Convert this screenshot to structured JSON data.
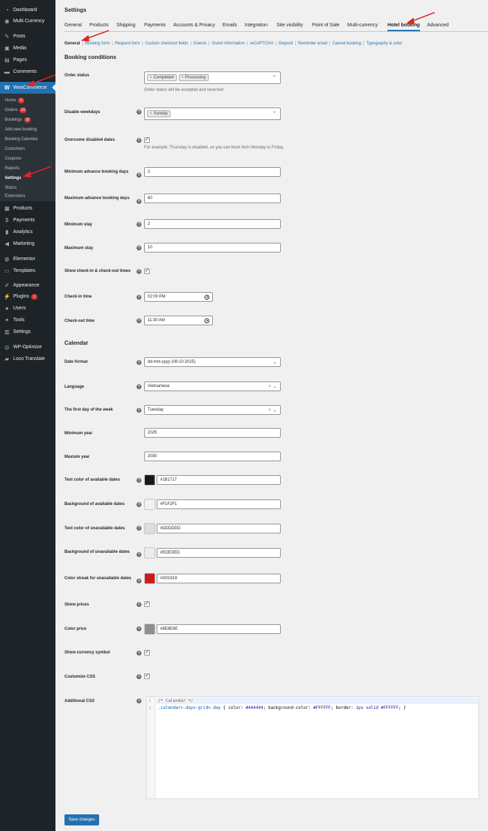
{
  "sidebar": {
    "items": [
      {
        "label": "Dashboard",
        "icon": "dashboard-icon",
        "glyph": "◔"
      },
      {
        "label": "Multi Currency",
        "icon": "currency-icon",
        "glyph": "◉"
      },
      {
        "label": "Posts",
        "icon": "pin-icon",
        "glyph": "✎"
      },
      {
        "label": "Media",
        "icon": "media-icon",
        "glyph": "▣"
      },
      {
        "label": "Pages",
        "icon": "pages-icon",
        "glyph": "▤"
      },
      {
        "label": "Comments",
        "icon": "comment-icon",
        "glyph": "▬"
      },
      {
        "label": "WooCommerce",
        "icon": "woocommerce-icon",
        "glyph": "W"
      },
      {
        "label": "Products",
        "icon": "products-icon",
        "glyph": "▦"
      },
      {
        "label": "Payments",
        "icon": "payments-icon",
        "glyph": "$"
      },
      {
        "label": "Analytics",
        "icon": "analytics-icon",
        "glyph": "▮"
      },
      {
        "label": "Marketing",
        "icon": "megaphone-icon",
        "glyph": "◀"
      },
      {
        "label": "Elementor",
        "icon": "elementor-icon",
        "glyph": "◍"
      },
      {
        "label": "Templates",
        "icon": "folder-icon",
        "glyph": "▭"
      },
      {
        "label": "Appearance",
        "icon": "brush-icon",
        "glyph": "✐"
      },
      {
        "label": "Plugins",
        "icon": "plugin-icon",
        "glyph": "⚡",
        "badge": "1"
      },
      {
        "label": "Users",
        "icon": "user-icon",
        "glyph": "●"
      },
      {
        "label": "Tools",
        "icon": "wrench-icon",
        "glyph": "✦"
      },
      {
        "label": "Settings",
        "icon": "settings-icon",
        "glyph": "▥"
      },
      {
        "label": "WP-Optimize",
        "icon": "optimize-icon",
        "glyph": "◎"
      },
      {
        "label": "Loco Translate",
        "icon": "translate-icon",
        "glyph": "▰"
      }
    ],
    "submenu": [
      {
        "label": "Home",
        "badge": "5"
      },
      {
        "label": "Orders",
        "badge": "10"
      },
      {
        "label": "Bookings",
        "badge": "10"
      },
      {
        "label": "Add new booking"
      },
      {
        "label": "Booking Calendar"
      },
      {
        "label": "Customers"
      },
      {
        "label": "Coupons"
      },
      {
        "label": "Reports"
      },
      {
        "label": "Settings"
      },
      {
        "label": "Status"
      },
      {
        "label": "Extensions"
      }
    ]
  },
  "page": {
    "title": "Settings"
  },
  "tabs": [
    "General",
    "Products",
    "Shipping",
    "Payments",
    "Accounts & Privacy",
    "Emails",
    "Integration",
    "Site visibility",
    "Point of Sale",
    "Multi-currency",
    "Hotel booking",
    "Advanced"
  ],
  "subtabs": [
    "General",
    "Booking form",
    "Request form",
    "Custom checkout fields",
    "Guests",
    "Guest information",
    "reCAPTCHA",
    "Deposit",
    "Reminder email",
    "Cancel booking",
    "Typography & color"
  ],
  "booking": {
    "title": "Booking conditions",
    "order_status_label": "Order status",
    "order_status_chips": [
      "Completed",
      "Processing"
    ],
    "order_status_desc": "Order status will be accepted and reserved",
    "disable_weekdays_label": "Disable weekdays",
    "disable_weekdays_chips": [
      "Sunday"
    ],
    "overcome_label": "Overcome disabled dates",
    "overcome_desc": "For example: Thursday is disabled, so you can book form Monday to Friday.",
    "min_advance_label": "Minimum advance booking days",
    "min_advance_value": "2",
    "max_advance_label": "Maximum advance booking days",
    "max_advance_value": "60",
    "min_stay_label": "Minimum stay",
    "min_stay_value": "2",
    "max_stay_label": "Maximum stay",
    "max_stay_value": "10",
    "show_checkin_label": "Show check-in & check-out times",
    "checkin_label": "Check-in time",
    "checkin_value": "02:00 PM",
    "checkout_label": "Check-out time",
    "checkout_value": "11:30 AM"
  },
  "calendar": {
    "title": "Calendar",
    "date_format_label": "Date format",
    "date_format_value": "dd-mm-yyyy (08-10-2025)",
    "language_label": "Language",
    "language_value": "Vietnamese",
    "first_day_label": "The first day of the week",
    "first_day_value": "Tuesday",
    "min_year_label": "Minimum year",
    "min_year_value": "2025",
    "max_year_label": "Maxium year",
    "max_year_value": "2030",
    "text_avail_label": "Text color of available dates",
    "text_avail_value": "#1B1717",
    "bg_avail_label": "Background of available dates",
    "bg_avail_value": "#F1F2F1",
    "text_unavail_label": "Text color of unavailable dates",
    "text_unavail_value": "#DDDDDD",
    "bg_unavail_label": "Background of unavailable dates",
    "bg_unavail_value": "#EDEDED",
    "streak_label": "Color streak for unavailable dates",
    "streak_value": "#D01919",
    "show_prices_label": "Show prices",
    "color_price_label": "Color price",
    "color_price_value": "#8E8E8E",
    "show_currency_label": "Show currency symbol",
    "customize_css_label": "Customize CSS",
    "additional_css_label": "Additional CSS",
    "code_line1": "/* Calendar */",
    "code_line2_sel": ".calendar>.days-grid>.day",
    "code_line2_rest1": " { color: ",
    "code_line2_v1": "#444444",
    "code_line2_rest2": "; background-color: ",
    "code_line2_v2": "#FFFFFF",
    "code_line2_rest3": "; border: ",
    "code_line2_v3": "1px solid #FFFFFF",
    "code_line2_end": "; }",
    "line_numbers": [
      "1",
      "2"
    ]
  },
  "save_label": "Save changes",
  "colors": {
    "accent": "#2271b1",
    "arrow": "#e02424"
  }
}
